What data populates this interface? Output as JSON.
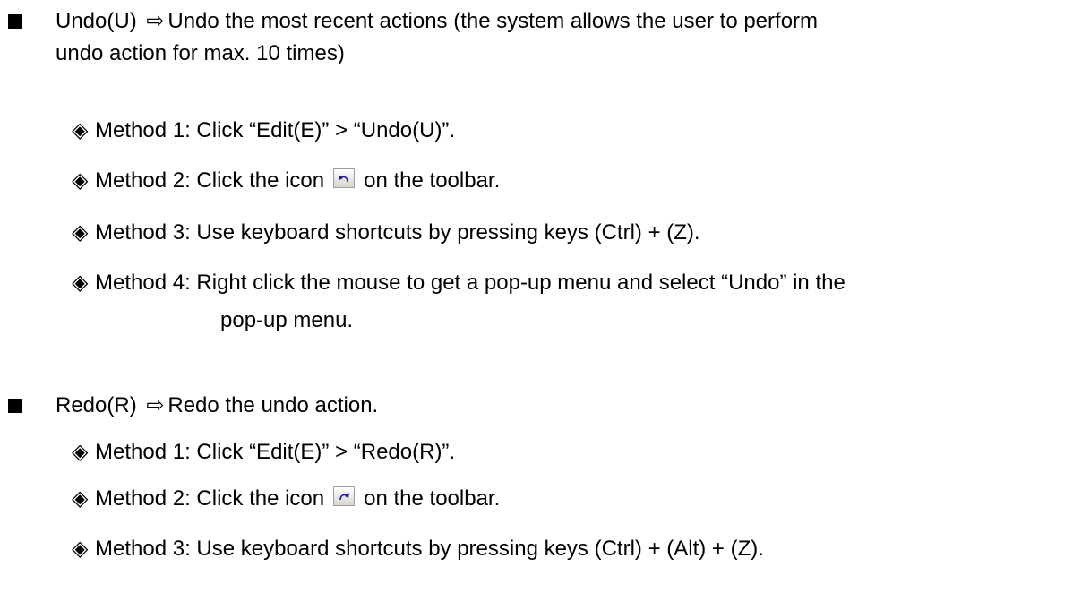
{
  "items": [
    {
      "bullet_name": "undo",
      "heading": {
        "term": "Undo(U)",
        "arrow": "⇨",
        "desc_line1": "Undo the most recent actions (the system allows the user to perform",
        "desc_line2": "undo action for max. 10 times)"
      },
      "methods": [
        {
          "marker": "◈",
          "text": "Method 1: Click “Edit(E)” > “Undo(U)”."
        },
        {
          "marker": "◈",
          "text_before": "Method 2: Click the icon",
          "icon": "undo-icon",
          "text_after": "on the toolbar."
        },
        {
          "marker": "◈",
          "text": "Method 3: Use keyboard shortcuts by pressing keys (Ctrl) + (Z)."
        },
        {
          "marker": "◈",
          "text": "Method 4: Right click the mouse to get a pop-up menu and select “Undo” in the",
          "cont": "pop-up menu."
        }
      ]
    },
    {
      "bullet_name": "redo",
      "heading": {
        "term": "Redo(R)",
        "arrow": "⇨",
        "desc_line1": "Redo the undo action."
      },
      "methods": [
        {
          "marker": "◈",
          "text": "Method 1: Click “Edit(E)” > “Redo(R)”."
        },
        {
          "marker": "◈",
          "text_before": "Method 2: Click the icon",
          "icon": "redo-icon",
          "text_after": "on the toolbar."
        },
        {
          "marker": "◈",
          "text": "Method 3: Use keyboard shortcuts by pressing keys (Ctrl) + (Alt) + (Z)."
        }
      ]
    }
  ],
  "colors": {
    "text": "#000000",
    "icon_arrow": "#1a1aa8",
    "icon_border": "#a0a0a0"
  }
}
